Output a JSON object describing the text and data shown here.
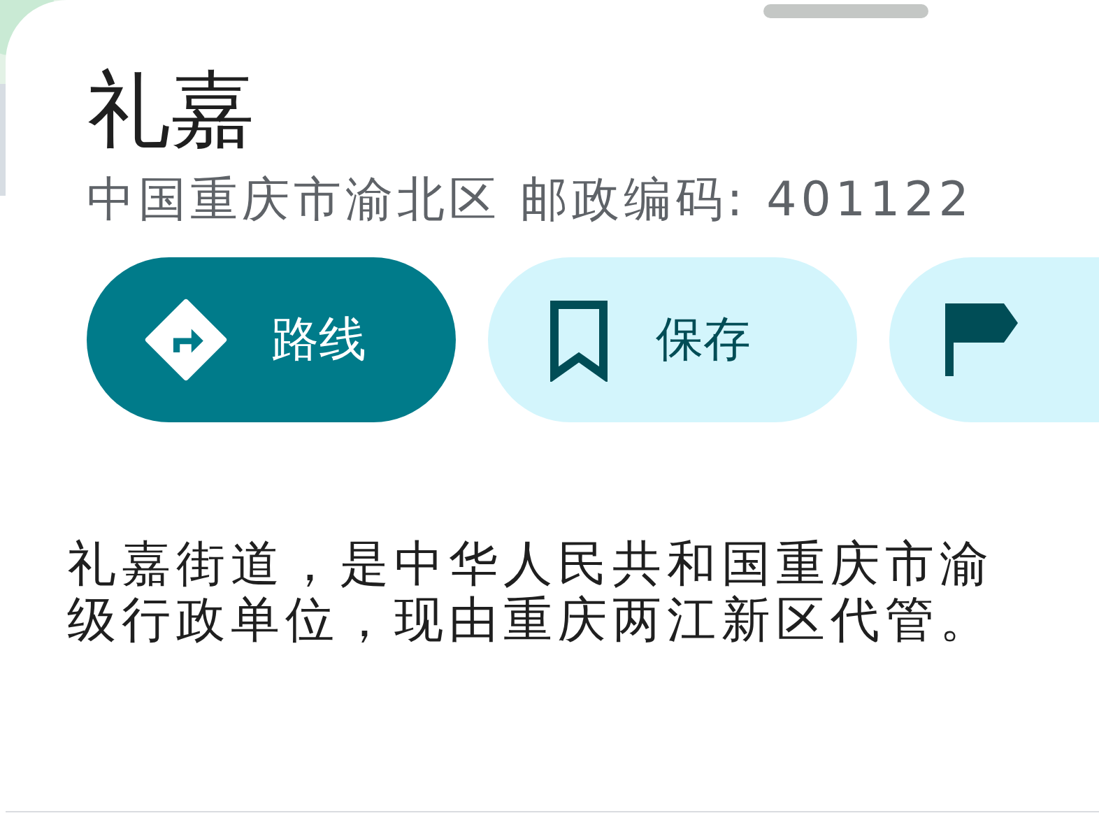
{
  "place": {
    "title": "礼嘉",
    "address": "中国重庆市渝北区 邮政编码: 401122"
  },
  "actions": [
    {
      "kind": "directions",
      "label": "路线",
      "primary": true
    },
    {
      "kind": "save",
      "label": "保存",
      "primary": false
    },
    {
      "kind": "flag",
      "primary": false
    }
  ],
  "description": {
    "lines": [
      "礼嘉街道，是中华人民共和国重庆市渝",
      "级行政单位，现由重庆两江新区代管。"
    ]
  }
}
